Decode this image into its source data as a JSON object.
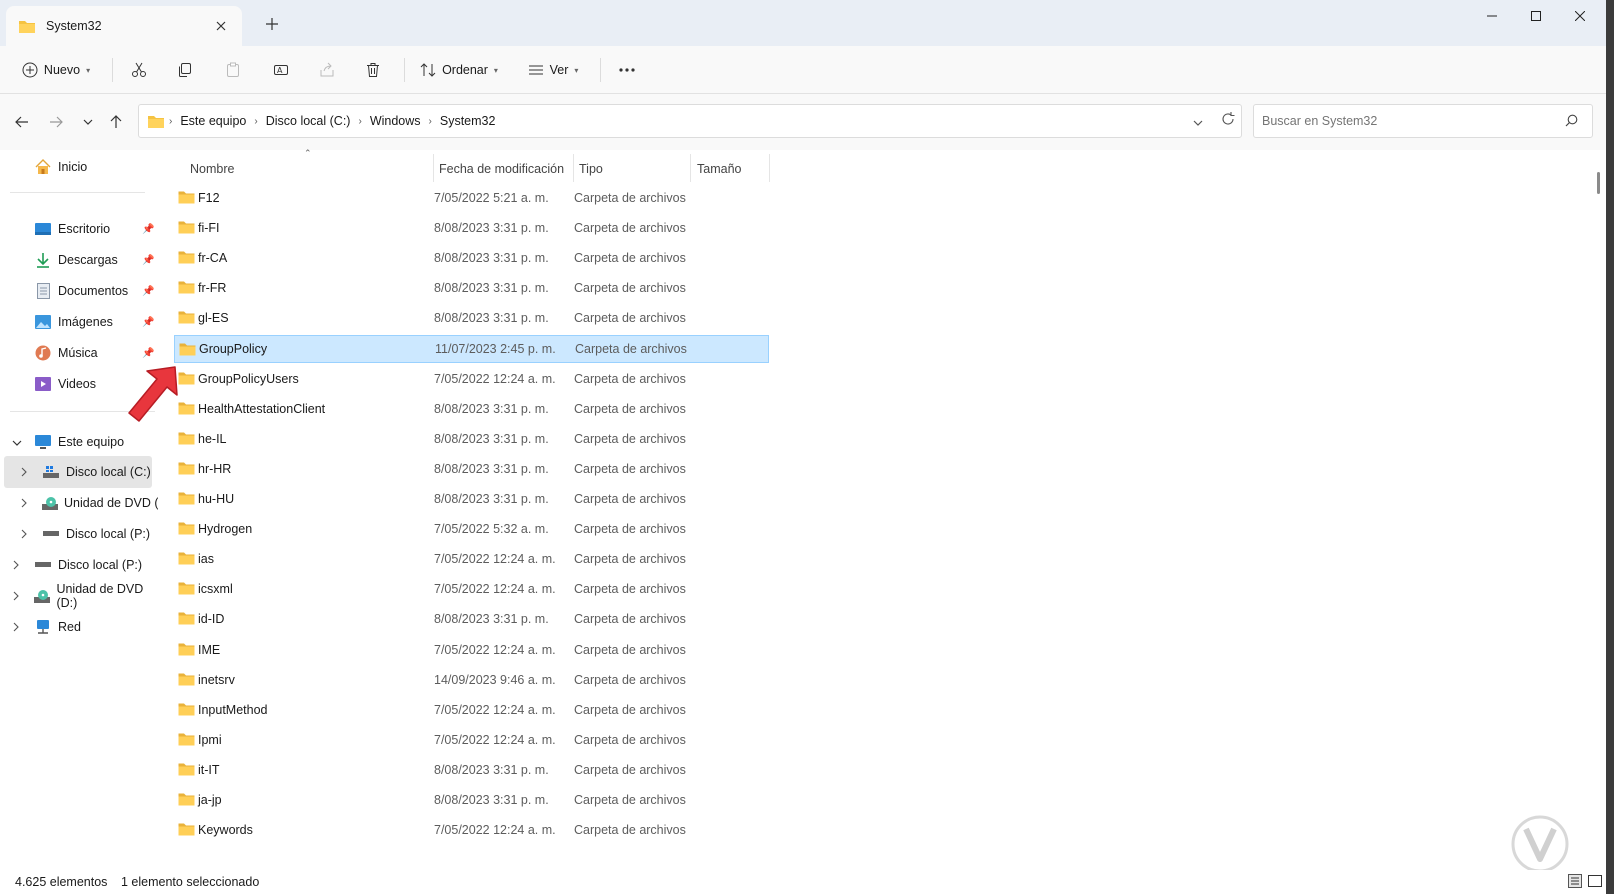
{
  "window": {
    "tab_title": "System32",
    "colors": {
      "accent": "#0067c0",
      "selection_bg": "#cce8ff",
      "selection_border": "#99d1ff",
      "folder": "#f5c342",
      "arrow": "#e8363d"
    }
  },
  "toolbar": {
    "new_label": "Nuevo",
    "sort_label": "Ordenar",
    "view_label": "Ver",
    "icons": [
      "cut-icon",
      "copy-icon",
      "paste-icon",
      "rename-icon",
      "share-icon",
      "delete-icon",
      "more-icon"
    ]
  },
  "address": {
    "crumbs": [
      "Este equipo",
      "Disco local (C:)",
      "Windows",
      "System32"
    ]
  },
  "search": {
    "placeholder": "Buscar en System32"
  },
  "sidebar": {
    "home": "Inicio",
    "quick": [
      "Escritorio",
      "Descargas",
      "Documentos",
      "Imágenes",
      "Música",
      "Videos"
    ],
    "tree": {
      "this_pc": "Este equipo",
      "children": [
        "Disco local (C:)",
        "Unidad de DVD (D",
        "Disco local (P:)"
      ],
      "roots": [
        "Disco local (P:)",
        "Unidad de DVD (D:)",
        "Red"
      ]
    }
  },
  "columns": {
    "name": "Nombre",
    "date": "Fecha de modificación",
    "type": "Tipo",
    "size": "Tamaño"
  },
  "files": [
    {
      "name": "F12",
      "date": "7/05/2022 5:21 a. m.",
      "type": "Carpeta de archivos"
    },
    {
      "name": "fi-FI",
      "date": "8/08/2023 3:31 p. m.",
      "type": "Carpeta de archivos"
    },
    {
      "name": "fr-CA",
      "date": "8/08/2023 3:31 p. m.",
      "type": "Carpeta de archivos"
    },
    {
      "name": "fr-FR",
      "date": "8/08/2023 3:31 p. m.",
      "type": "Carpeta de archivos"
    },
    {
      "name": "gl-ES",
      "date": "8/08/2023 3:31 p. m.",
      "type": "Carpeta de archivos"
    },
    {
      "name": "GroupPolicy",
      "date": "11/07/2023 2:45 p. m.",
      "type": "Carpeta de archivos"
    },
    {
      "name": "GroupPolicyUsers",
      "date": "7/05/2022 12:24 a. m.",
      "type": "Carpeta de archivos"
    },
    {
      "name": "HealthAttestationClient",
      "date": "8/08/2023 3:31 p. m.",
      "type": "Carpeta de archivos"
    },
    {
      "name": "he-IL",
      "date": "8/08/2023 3:31 p. m.",
      "type": "Carpeta de archivos"
    },
    {
      "name": "hr-HR",
      "date": "8/08/2023 3:31 p. m.",
      "type": "Carpeta de archivos"
    },
    {
      "name": "hu-HU",
      "date": "8/08/2023 3:31 p. m.",
      "type": "Carpeta de archivos"
    },
    {
      "name": "Hydrogen",
      "date": "7/05/2022 5:32 a. m.",
      "type": "Carpeta de archivos"
    },
    {
      "name": "ias",
      "date": "7/05/2022 12:24 a. m.",
      "type": "Carpeta de archivos"
    },
    {
      "name": "icsxml",
      "date": "7/05/2022 12:24 a. m.",
      "type": "Carpeta de archivos"
    },
    {
      "name": "id-ID",
      "date": "8/08/2023 3:31 p. m.",
      "type": "Carpeta de archivos"
    },
    {
      "name": "IME",
      "date": "7/05/2022 12:24 a. m.",
      "type": "Carpeta de archivos"
    },
    {
      "name": "inetsrv",
      "date": "14/09/2023 9:46 a. m.",
      "type": "Carpeta de archivos"
    },
    {
      "name": "InputMethod",
      "date": "7/05/2022 12:24 a. m.",
      "type": "Carpeta de archivos"
    },
    {
      "name": "Ipmi",
      "date": "7/05/2022 12:24 a. m.",
      "type": "Carpeta de archivos"
    },
    {
      "name": "it-IT",
      "date": "8/08/2023 3:31 p. m.",
      "type": "Carpeta de archivos"
    },
    {
      "name": "ja-jp",
      "date": "8/08/2023 3:31 p. m.",
      "type": "Carpeta de archivos"
    },
    {
      "name": "Keywords",
      "date": "7/05/2022 12:24 a. m.",
      "type": "Carpeta de archivos"
    }
  ],
  "selected_file": "GroupPolicy",
  "status": {
    "count": "4.625 elementos",
    "selection": "1 elemento seleccionado"
  }
}
